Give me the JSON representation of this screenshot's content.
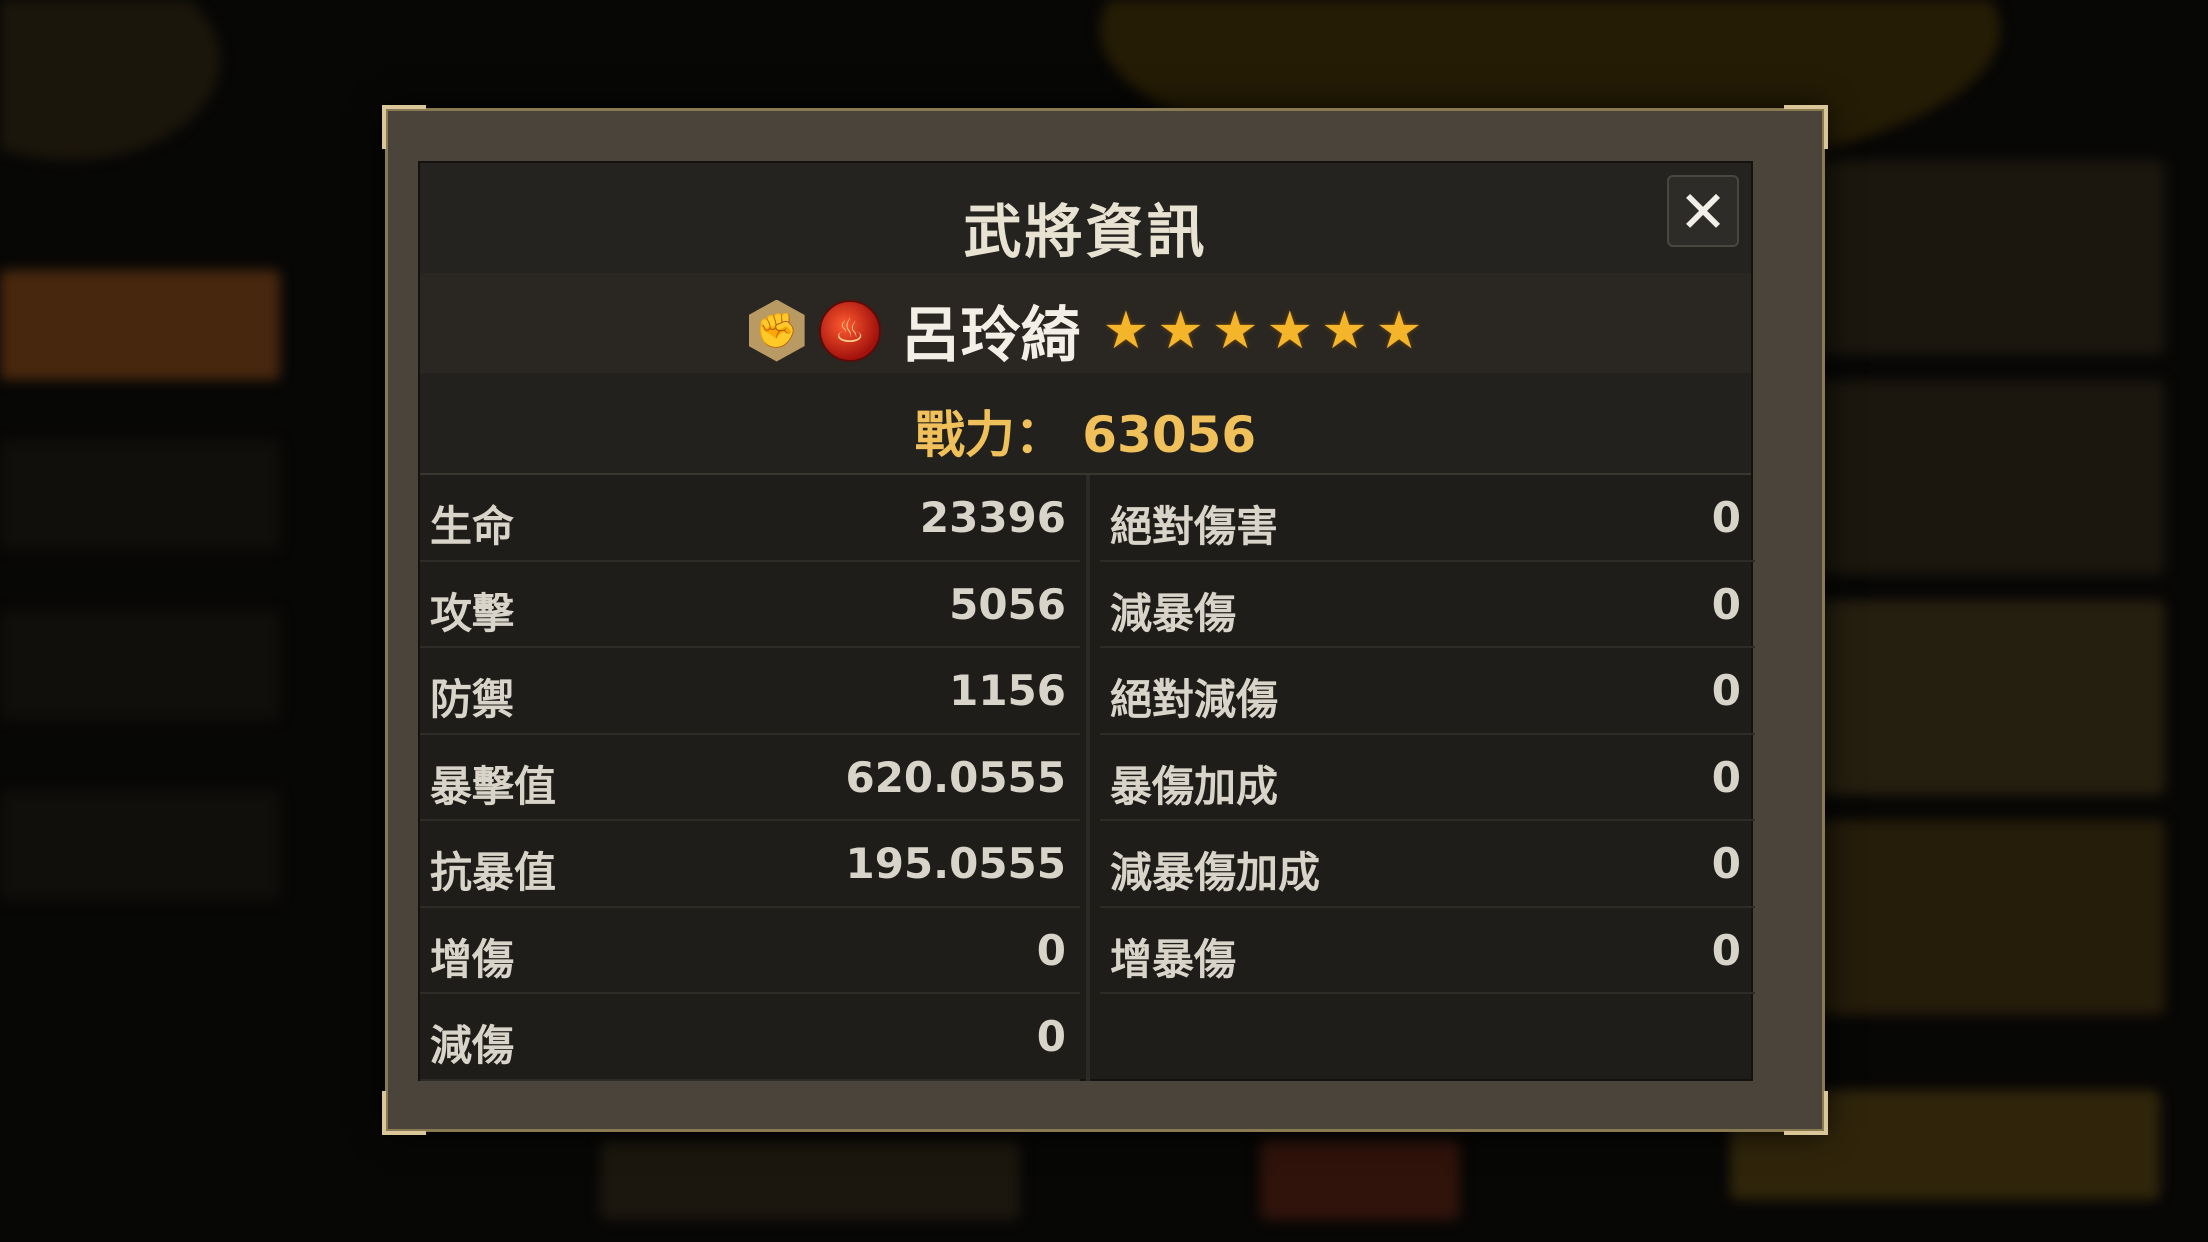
{
  "dialog": {
    "title": "武將資訊",
    "close_icon": "✕"
  },
  "hero": {
    "class_icon": "fist-icon",
    "element_icon": "fire-icon",
    "name": "呂玲綺",
    "stars": 6
  },
  "power": {
    "label": "戰力：",
    "value": "63056"
  },
  "stats_left": [
    {
      "label": "生命",
      "value": "23396"
    },
    {
      "label": "攻擊",
      "value": "5056"
    },
    {
      "label": "防禦",
      "value": "1156"
    },
    {
      "label": "暴擊值",
      "value": "620.0555"
    },
    {
      "label": "抗暴值",
      "value": "195.0555"
    },
    {
      "label": "增傷",
      "value": "0"
    },
    {
      "label": "減傷",
      "value": "0"
    }
  ],
  "stats_right": [
    {
      "label": "絕對傷害",
      "value": "0"
    },
    {
      "label": "減暴傷",
      "value": "0"
    },
    {
      "label": "絕對減傷",
      "value": "0"
    },
    {
      "label": "暴傷加成",
      "value": "0"
    },
    {
      "label": "減暴傷加成",
      "value": "0"
    },
    {
      "label": "增暴傷",
      "value": "0"
    }
  ],
  "colors": {
    "title": "#e8e2d2",
    "power": "#f0c05a",
    "star": "#f5b52a",
    "element": "#c8201a"
  }
}
